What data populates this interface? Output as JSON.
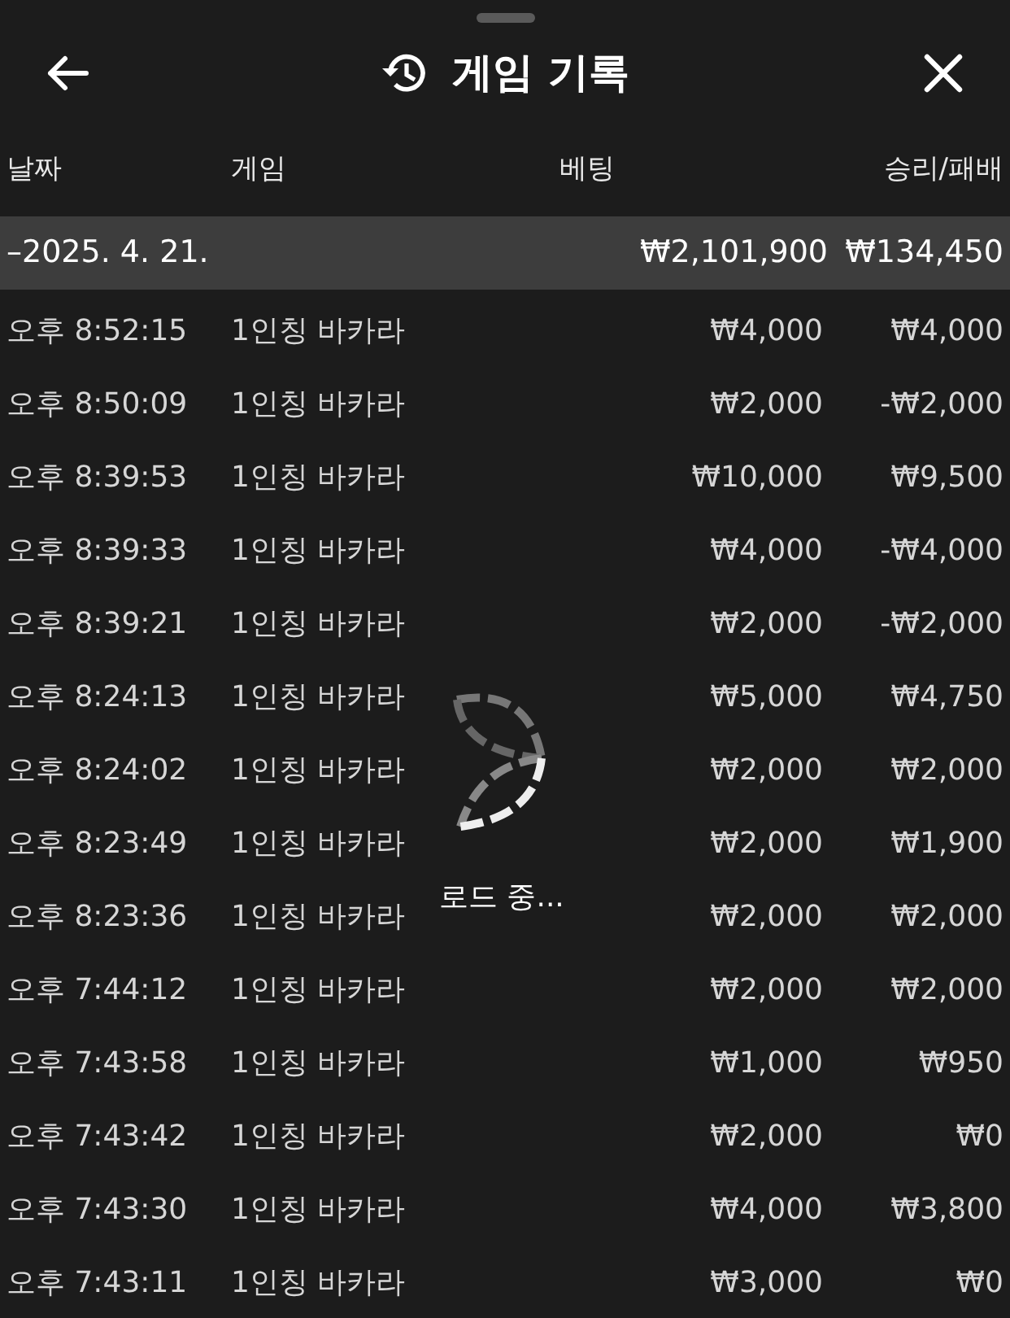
{
  "header": {
    "title": "게임 기록"
  },
  "columns": [
    "날짜",
    "게임",
    "베팅",
    "승리/패배"
  ],
  "date_group": {
    "date": "–2025. 4. 21.",
    "bet": "₩2,101,900",
    "result": "₩134,450"
  },
  "rows": [
    {
      "time": "오후 8:52:15",
      "game": "1인칭 바카라",
      "bet": "₩4,000",
      "result": "₩4,000"
    },
    {
      "time": "오후 8:50:09",
      "game": "1인칭 바카라",
      "bet": "₩2,000",
      "result": "-₩2,000"
    },
    {
      "time": "오후 8:39:53",
      "game": "1인칭 바카라",
      "bet": "₩10,000",
      "result": "₩9,500"
    },
    {
      "time": "오후 8:39:33",
      "game": "1인칭 바카라",
      "bet": "₩4,000",
      "result": "-₩4,000"
    },
    {
      "time": "오후 8:39:21",
      "game": "1인칭 바카라",
      "bet": "₩2,000",
      "result": "-₩2,000"
    },
    {
      "time": "오후 8:24:13",
      "game": "1인칭 바카라",
      "bet": "₩5,000",
      "result": "₩4,750"
    },
    {
      "time": "오후 8:24:02",
      "game": "1인칭 바카라",
      "bet": "₩2,000",
      "result": "₩2,000"
    },
    {
      "time": "오후 8:23:49",
      "game": "1인칭 바카라",
      "bet": "₩2,000",
      "result": "₩1,900"
    },
    {
      "time": "오후 8:23:36",
      "game": "1인칭 바카라",
      "bet": "₩2,000",
      "result": "₩2,000"
    },
    {
      "time": "오후 7:44:12",
      "game": "1인칭 바카라",
      "bet": "₩2,000",
      "result": "₩2,000"
    },
    {
      "time": "오후 7:43:58",
      "game": "1인칭 바카라",
      "bet": "₩1,000",
      "result": "₩950"
    },
    {
      "time": "오후 7:43:42",
      "game": "1인칭 바카라",
      "bet": "₩2,000",
      "result": "₩0"
    },
    {
      "time": "오후 7:43:30",
      "game": "1인칭 바카라",
      "bet": "₩4,000",
      "result": "₩3,800"
    },
    {
      "time": "오후 7:43:11",
      "game": "1인칭 바카라",
      "bet": "₩3,000",
      "result": "₩0"
    }
  ],
  "loading": {
    "label": "로드 중..."
  }
}
